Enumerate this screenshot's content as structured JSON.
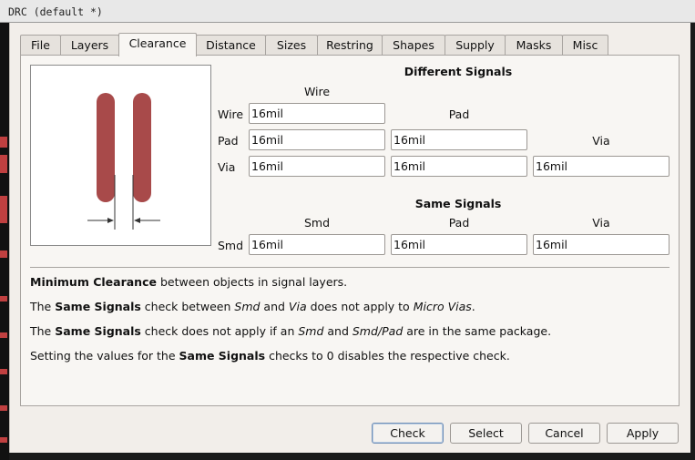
{
  "window": {
    "title": "DRC (default *)"
  },
  "tabs": [
    {
      "label": "File"
    },
    {
      "label": "Layers"
    },
    {
      "label": "Clearance"
    },
    {
      "label": "Distance"
    },
    {
      "label": "Sizes"
    },
    {
      "label": "Restring"
    },
    {
      "label": "Shapes"
    },
    {
      "label": "Supply"
    },
    {
      "label": "Masks"
    },
    {
      "label": "Misc"
    }
  ],
  "active_tab": "Clearance",
  "different_signals": {
    "heading": "Different Signals",
    "col_wire": "Wire",
    "col_pad": "Pad",
    "col_via": "Via",
    "row_wire": "Wire",
    "row_pad": "Pad",
    "row_via": "Via",
    "wire_wire": "16mil",
    "pad_wire": "16mil",
    "pad_pad": "16mil",
    "via_wire": "16mil",
    "via_pad": "16mil",
    "via_via": "16mil"
  },
  "same_signals": {
    "heading": "Same Signals",
    "col_smd": "Smd",
    "col_pad": "Pad",
    "col_via": "Via",
    "row_smd": "Smd",
    "smd_smd": "16mil",
    "smd_pad": "16mil",
    "smd_via": "16mil"
  },
  "description": {
    "l1_b": "Minimum Clearance",
    "l1_t": " between objects in signal layers.",
    "l2_a": "The ",
    "l2_b": "Same Signals",
    "l2_c": " check between ",
    "l2_i1": "Smd",
    "l2_d": " and ",
    "l2_i2": "Via",
    "l2_e": " does not apply to ",
    "l2_i3": "Micro Vias",
    "l2_f": ".",
    "l3_a": "The ",
    "l3_b": "Same Signals",
    "l3_c": " check does not apply if an ",
    "l3_i1": "Smd",
    "l3_d": " and ",
    "l3_i2": "Smd/Pad",
    "l3_e": " are in the same package.",
    "l4_a": "Setting the values for the ",
    "l4_b": "Same Signals",
    "l4_c": " checks to 0 disables the respective check."
  },
  "buttons": {
    "check": "Check",
    "select": "Select",
    "cancel": "Cancel",
    "apply": "Apply"
  },
  "colors": {
    "trace": "#a84a4a",
    "dialog_bg": "#f2eeea",
    "panel_bg": "#f8f6f3"
  }
}
